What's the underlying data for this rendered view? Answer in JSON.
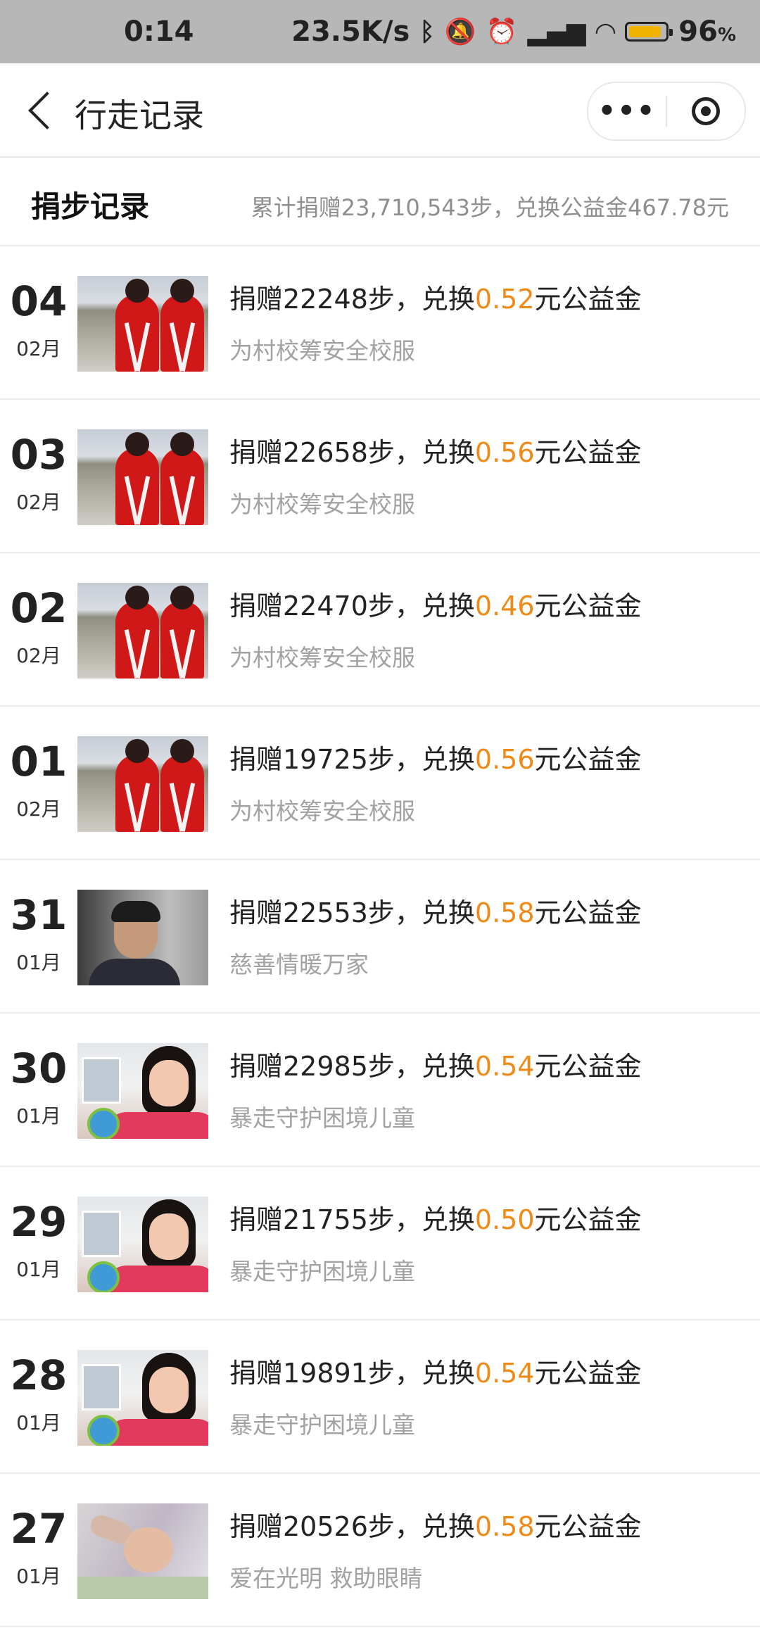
{
  "status_bar": {
    "time": "0:14",
    "net_speed": "23.5K/s",
    "battery": "96"
  },
  "nav": {
    "title": "行走记录",
    "more_icon": "more-dots-icon",
    "close_icon": "target-close-icon"
  },
  "summary": {
    "title": "捐步记录",
    "total_text": "累计捐赠23,710,543步，兑换公益金467.78元"
  },
  "records": [
    {
      "day": "04",
      "month": "02月",
      "prefix": "捐赠22248步，兑换",
      "amount": "0.52",
      "suffix": "元公益金",
      "project": "为村校筹安全校服",
      "thumb": "uniform"
    },
    {
      "day": "03",
      "month": "02月",
      "prefix": "捐赠22658步，兑换",
      "amount": "0.56",
      "suffix": "元公益金",
      "project": "为村校筹安全校服",
      "thumb": "uniform"
    },
    {
      "day": "02",
      "month": "02月",
      "prefix": "捐赠22470步，兑换",
      "amount": "0.46",
      "suffix": "元公益金",
      "project": "为村校筹安全校服",
      "thumb": "uniform"
    },
    {
      "day": "01",
      "month": "02月",
      "prefix": "捐赠19725步，兑换",
      "amount": "0.56",
      "suffix": "元公益金",
      "project": "为村校筹安全校服",
      "thumb": "uniform"
    },
    {
      "day": "31",
      "month": "01月",
      "prefix": "捐赠22553步，兑换",
      "amount": "0.58",
      "suffix": "元公益金",
      "project": "慈善情暖万家",
      "thumb": "boy"
    },
    {
      "day": "30",
      "month": "01月",
      "prefix": "捐赠22985步，兑换",
      "amount": "0.54",
      "suffix": "元公益金",
      "project": "暴走守护困境儿童",
      "thumb": "girl"
    },
    {
      "day": "29",
      "month": "01月",
      "prefix": "捐赠21755步，兑换",
      "amount": "0.50",
      "suffix": "元公益金",
      "project": "暴走守护困境儿童",
      "thumb": "girl"
    },
    {
      "day": "28",
      "month": "01月",
      "prefix": "捐赠19891步，兑换",
      "amount": "0.54",
      "suffix": "元公益金",
      "project": "暴走守护困境儿童",
      "thumb": "girl"
    },
    {
      "day": "27",
      "month": "01月",
      "prefix": "捐赠20526步，兑换",
      "amount": "0.58",
      "suffix": "元公益金",
      "project": "爱在光明 救助眼睛",
      "thumb": "baby"
    }
  ],
  "colors": {
    "amount": "#f08a16",
    "subtext": "#a2a2a2",
    "statusbar_bg": "#b7b7b7"
  }
}
